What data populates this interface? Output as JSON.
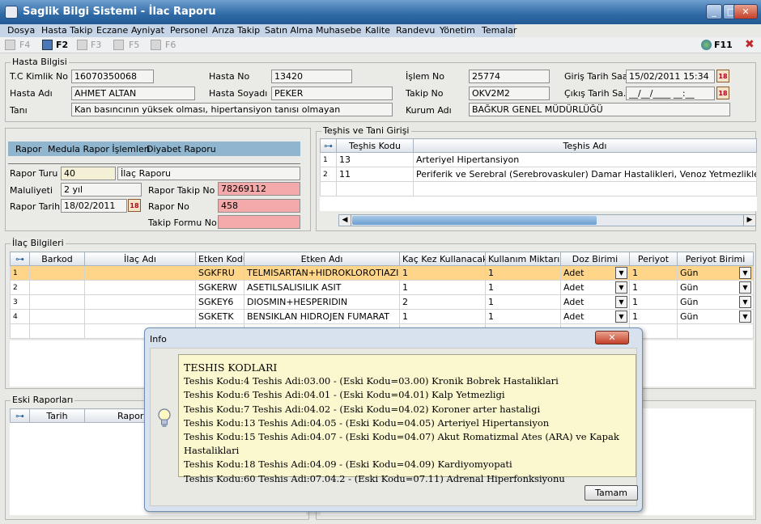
{
  "window": {
    "title": "Saglik Bilgi Sistemi - İlac Raporu",
    "min": "_",
    "max": "□",
    "close": "✕"
  },
  "menu": [
    "Dosya",
    "Hasta Takip",
    "Eczane",
    "Ayniyat",
    "Personel",
    "Arıza Takip",
    "Satın Alma",
    "Muhasebe",
    "Kalite",
    "Randevu",
    "Yönetim",
    "Temalar"
  ],
  "toolbar": {
    "f4": "F4",
    "f2": "F2",
    "f3": "F3",
    "f5": "F5",
    "f6": "F6",
    "f11": "F11"
  },
  "hasta": {
    "legend": "Hasta Bilgisi",
    "tc_label": "T.C Kimlik No",
    "tc": "16070350068",
    "hastano_label": "Hasta No",
    "hastano": "13420",
    "islemno_label": "İşlem No",
    "islemno": "25774",
    "giris_label": "Giriş Tarih Saati",
    "giris": "15/02/2011 15:34",
    "adi_label": "Hasta Adı",
    "adi": "AHMET ALTAN",
    "soyadi_label": "Hasta Soyadı",
    "soyadi": "PEKER",
    "takipno_label": "Takip No",
    "takipno": "OKV2M2",
    "cikis_label": "Çıkış Tarih Sa...",
    "cikis": "__/__/____ __:__",
    "tani_label": "Tanı",
    "tani": "Kan basıncının yüksek olması, hipertansiyon tanısı olmayan",
    "kurum_label": "Kurum Adı",
    "kurum": "BAĞKUR GENEL MÜDÜRLÜĞÜ"
  },
  "rapor": {
    "tabs": [
      "Rapor",
      "Medula Rapor İşlemleri",
      "Diyabet Raporu"
    ],
    "turu_label": "Rapor Turu",
    "turu_code": "40",
    "turu": "İlaç Raporu",
    "maluliyet_label": "Maluliyeti",
    "maluliyet": "2 yıl",
    "takipno_label": "Rapor Takip No",
    "takipno": "78269112",
    "tarih_label": "Rapor Tarihi",
    "tarih": "18/02/2011",
    "no_label": "Rapor No",
    "no": "458",
    "formu_label": "Takip Formu No",
    "formu": ""
  },
  "teshis": {
    "legend": "Teşhis ve Tani Girişi",
    "headers": [
      "Teşhis Kodu",
      "Teşhis Adı"
    ],
    "rows": [
      {
        "n": "1",
        "kod": "13",
        "adi": "Arteriyel Hipertansiyon"
      },
      {
        "n": "2",
        "kod": "11",
        "adi": "Periferik ve Serebral (Serebrovaskuler) Damar Hastalikleri, Venoz Yetmezlikler"
      }
    ]
  },
  "ilac": {
    "legend": "İlaç Bilgileri",
    "headers": [
      "Barkod",
      "İlaç Adı",
      "Etken Kodu",
      "Etken Adı",
      "Kaç Kez Kullanacak",
      "Kullanım Miktarı",
      "Doz Birimi",
      "Periyot",
      "Periyot Birimi"
    ],
    "rows": [
      {
        "n": "1",
        "barkod": "",
        "adi": "",
        "kod": "SGKFRU",
        "etken": "TELMISARTAN+HIDROKLOROTIAZID",
        "kac": "1",
        "miktar": "1",
        "doz": "Adet",
        "periyot": "1",
        "birim": "Gün"
      },
      {
        "n": "2",
        "barkod": "",
        "adi": "",
        "kod": "SGKERW",
        "etken": "ASETILSALISILIK ASIT",
        "kac": "1",
        "miktar": "1",
        "doz": "Adet",
        "periyot": "1",
        "birim": "Gün"
      },
      {
        "n": "3",
        "barkod": "",
        "adi": "",
        "kod": "SGKEY6",
        "etken": "DIOSMIN+HESPERIDIN",
        "kac": "2",
        "miktar": "1",
        "doz": "Adet",
        "periyot": "1",
        "birim": "Gün"
      },
      {
        "n": "4",
        "barkod": "",
        "adi": "",
        "kod": "SGKETK",
        "etken": "BENSIKLAN HIDROJEN FUMARAT",
        "kac": "1",
        "miktar": "1",
        "doz": "Adet",
        "periyot": "1",
        "birim": "Gün"
      }
    ]
  },
  "eski": {
    "legend": "Eski Raporları",
    "headers": [
      "Tarih",
      "Rapor"
    ]
  },
  "dialog": {
    "title": "Info",
    "heading": "TESHIS KODLARI",
    "lines": [
      "Teshis Kodu:4 Teshis Adi:03.00 - (Eski Kodu=03.00) Kronik Bobrek Hastaliklari",
      "Teshis Kodu:6 Teshis Adi:04.01 - (Eski Kodu=04.01) Kalp Yetmezligi",
      "Teshis Kodu:7 Teshis Adi:04.02 - (Eski Kodu=04.02) Koroner arter hastaligi",
      "Teshis Kodu:13 Teshis Adi:04.05 - (Eski Kodu=04.05) Arteriyel Hipertansiyon",
      "Teshis Kodu:15 Teshis Adi:04.07 - (Eski Kodu=04.07) Akut Romatizmal Ates (ARA) ve Kapak Hastaliklari",
      "Teshis Kodu:18 Teshis Adi:04.09 - (Eski Kodu=04.09) Kardiyomyopati",
      "Teshis Kodu:60 Teshis Adi:07.04.2 - (Eski Kodu=07.11) Adrenal Hiperfonksiyonu"
    ],
    "ok": "Tamam"
  }
}
